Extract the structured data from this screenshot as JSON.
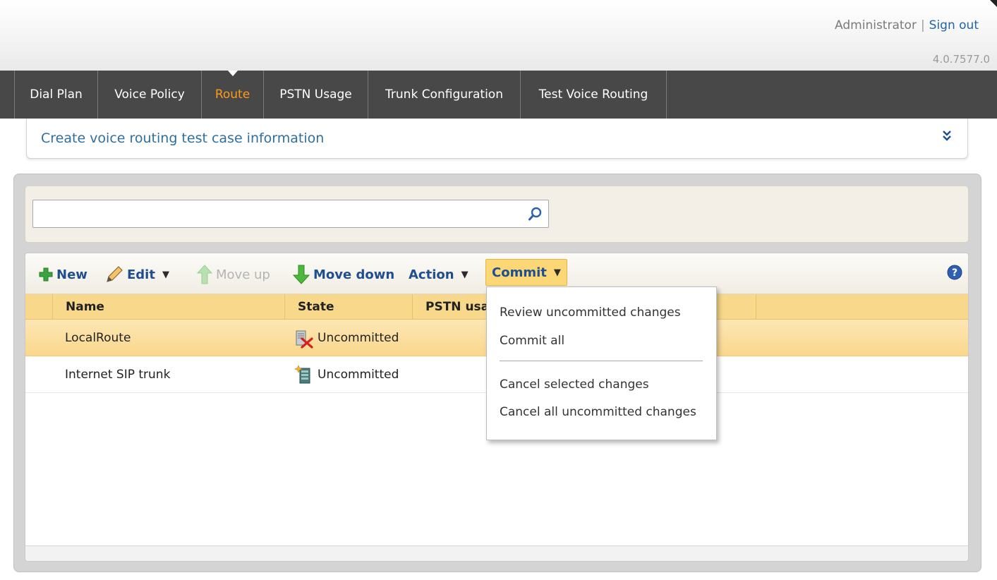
{
  "header": {
    "user_name": "Administrator",
    "separator": "|",
    "sign_out": "Sign out",
    "version": "4.0.7577.0"
  },
  "nav": {
    "tabs": [
      {
        "label": "Dial Plan",
        "active": false
      },
      {
        "label": "Voice Policy",
        "active": false
      },
      {
        "label": "Route",
        "active": true
      },
      {
        "label": "PSTN Usage",
        "active": false
      },
      {
        "label": "Trunk Configuration",
        "active": false
      },
      {
        "label": "Test Voice Routing",
        "active": false
      }
    ]
  },
  "infobar": {
    "text": "Create voice routing test case information",
    "icon": "double-chevron-down-icon"
  },
  "search": {
    "value": "",
    "placeholder": "",
    "icon": "search-icon"
  },
  "toolbar": {
    "new_label": "New",
    "edit_label": "Edit",
    "move_up_label": "Move up",
    "move_down_label": "Move down",
    "action_label": "Action",
    "commit_label": "Commit",
    "help_icon": "help-icon"
  },
  "grid": {
    "columns": [
      "Name",
      "State",
      "PSTN usa"
    ],
    "rows": [
      {
        "name": "LocalRoute",
        "state": "Uncommitted",
        "state_icon": "deleted-item-icon",
        "selected": true
      },
      {
        "name": "Internet SIP trunk",
        "state": "Uncommitted",
        "state_icon": "new-item-icon",
        "selected": false
      }
    ]
  },
  "commit_menu": {
    "items": [
      "Review uncommitted changes",
      "Commit all",
      "Cancel selected changes",
      "Cancel all uncommitted changes"
    ]
  },
  "colors": {
    "nav_bg": "#484848",
    "active_tab": "#ff9a1a",
    "link_blue": "#1f63a8",
    "header_row": "#f8d98b",
    "selected_row": "#f9d78c",
    "commit_button": "#fbd776"
  }
}
